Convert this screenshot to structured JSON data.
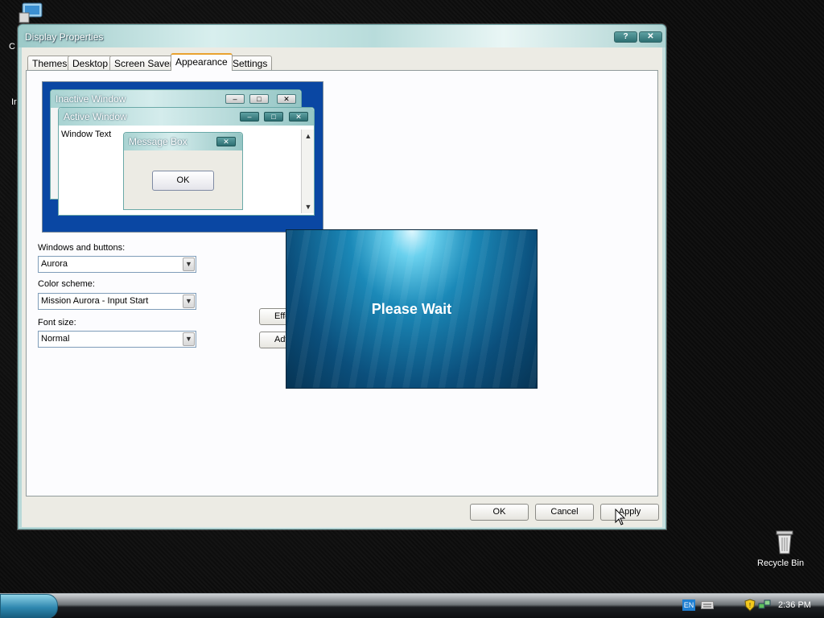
{
  "desktop": {
    "computer_label_fragment": "C",
    "internet_label_fragment": "Ir",
    "recycle_bin_label": "Recycle Bin"
  },
  "window": {
    "title": "Display Properties",
    "help_btn": "?",
    "close_btn": "✕"
  },
  "tabs": [
    {
      "label": "Themes"
    },
    {
      "label": "Desktop"
    },
    {
      "label": "Screen Saver"
    },
    {
      "label": "Appearance"
    },
    {
      "label": "Settings"
    }
  ],
  "active_tab": "Appearance",
  "preview": {
    "inactive_title": "Inactive Window",
    "active_title": "Active Window",
    "window_text": "Window Text",
    "message_box_title": "Message Box",
    "ok_label": "OK"
  },
  "form": {
    "windows_buttons_label": "Windows and buttons:",
    "windows_buttons_value": "Aurora",
    "color_scheme_label": "Color scheme:",
    "color_scheme_value": "Mission Aurora - Input Start",
    "font_size_label": "Font size:",
    "font_size_value": "Normal",
    "effects_btn_partial": "Effe",
    "advanced_btn_partial": "Adv"
  },
  "buttons": {
    "ok": "OK",
    "cancel": "Cancel",
    "apply": "Apply"
  },
  "overlay": {
    "text": "Please Wait"
  },
  "taskbar": {
    "language": "EN",
    "clock": "2:36 PM"
  },
  "colors": {
    "title_accent": "#9cc9c8",
    "active_tab_accent": "#e9a22f",
    "preview_desktop": "#0a47a3",
    "overlay_glow": "#6ad1ee"
  }
}
